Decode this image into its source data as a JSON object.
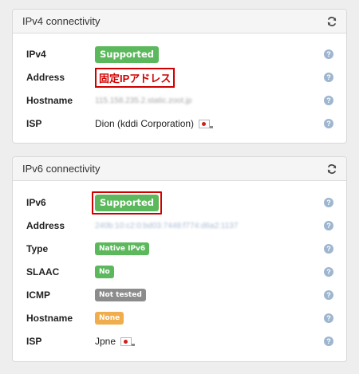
{
  "ipv4": {
    "title": "IPv4 connectivity",
    "refresh_icon": "refresh-icon",
    "rows": {
      "ipv4": {
        "label": "IPv4",
        "value": "Supported"
      },
      "address": {
        "label": "Address",
        "value": "固定IPアドレス"
      },
      "hostname": {
        "label": "Hostname",
        "value": "115.158.235.2.static.zoot.jp"
      },
      "isp": {
        "label": "ISP",
        "value": "Dion (kddi Corporation)"
      }
    }
  },
  "ipv6": {
    "title": "IPv6 connectivity",
    "refresh_icon": "refresh-icon",
    "rows": {
      "ipv6": {
        "label": "IPv6",
        "value": "Supported"
      },
      "address": {
        "label": "Address",
        "value": "240b:10:c2:0:bd03:7448:f774:d6a2:1137"
      },
      "type": {
        "label": "Type",
        "value": "Native IPv6"
      },
      "slaac": {
        "label": "SLAAC",
        "value": "No"
      },
      "icmp": {
        "label": "ICMP",
        "value": "Not tested"
      },
      "hostname": {
        "label": "Hostname",
        "value": "None"
      },
      "isp": {
        "label": "ISP",
        "value": "Jpne"
      }
    }
  },
  "help_glyph": "?",
  "colors": {
    "success": "#5cb85c",
    "muted": "#8c8c8c",
    "warning": "#f0ad4e",
    "highlight": "#d00000",
    "help": "#9eb6cf"
  }
}
